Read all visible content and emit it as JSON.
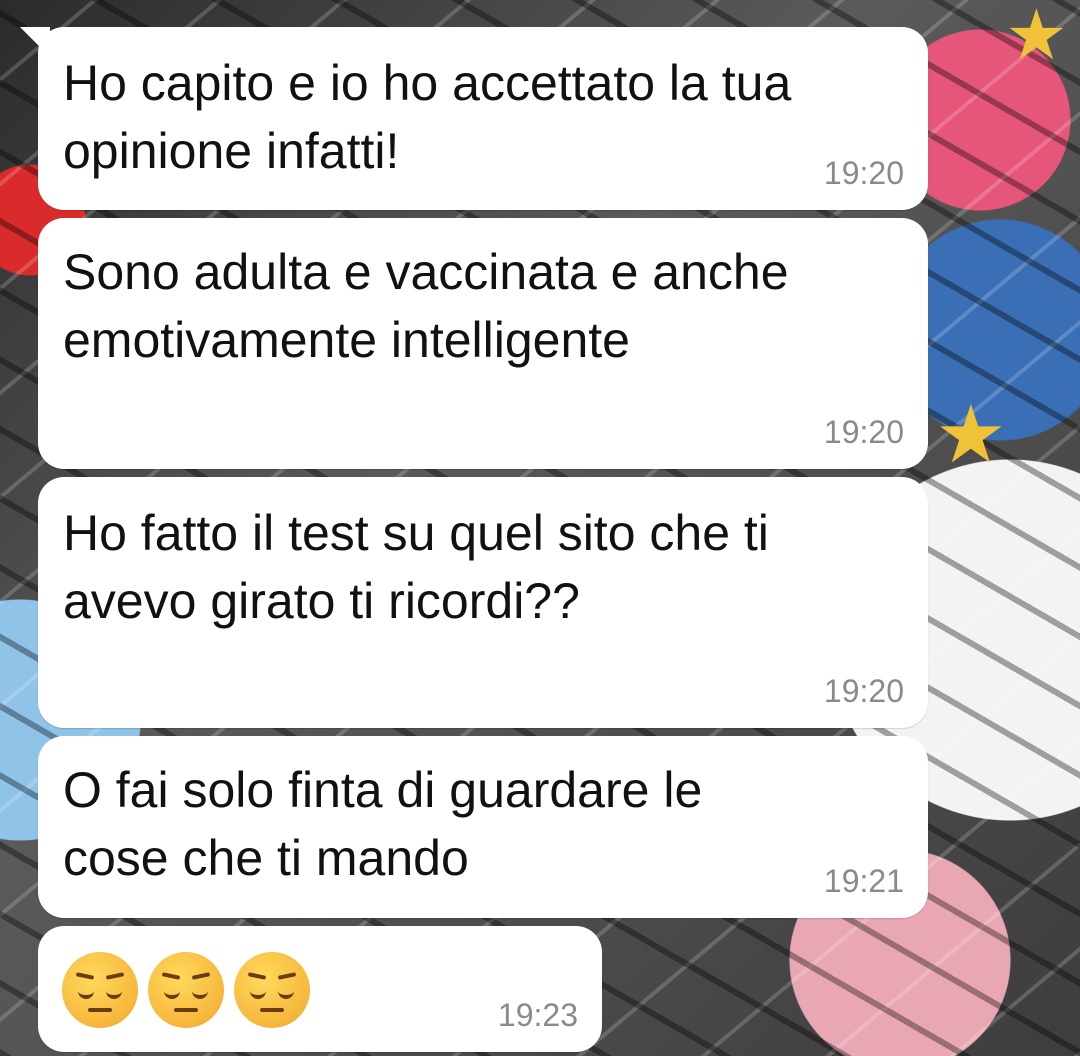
{
  "messages": [
    {
      "text": "Ho capito e io ho accettato la tua opinione infatti!",
      "time": "19:20"
    },
    {
      "text": "Sono adulta e vaccinata e anche emotivamente intelligente",
      "time": "19:20"
    },
    {
      "text": "Ho fatto il test su quel sito che ti avevo girato ti ricordi??",
      "time": "19:20"
    },
    {
      "text": "O fai solo finta di guardare le cose che ti mando",
      "time": "19:21"
    },
    {
      "text": "😔😔😔",
      "time": "19:23"
    }
  ],
  "emoji_icon": "pensive-face-icon"
}
